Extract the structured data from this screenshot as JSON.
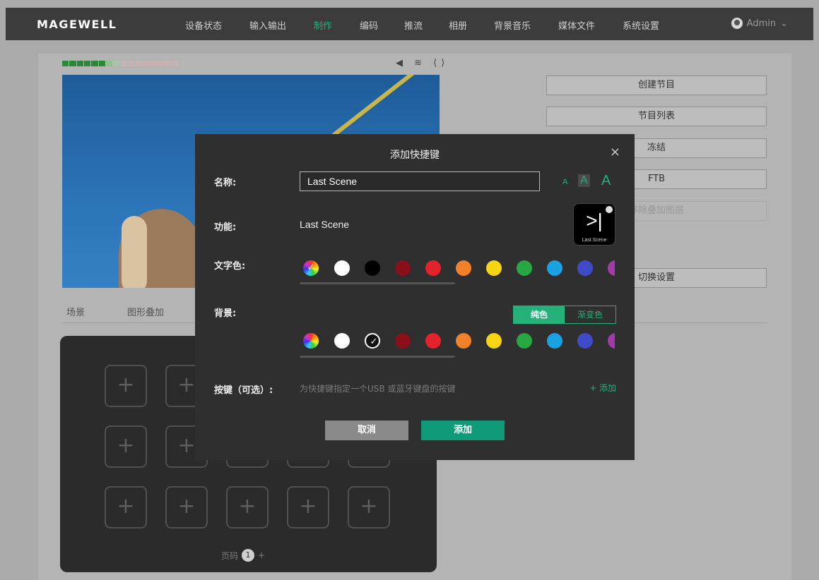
{
  "nav": {
    "logo": "MAGEWELL",
    "items": [
      {
        "label": "设备状态",
        "active": false
      },
      {
        "label": "输入输出",
        "active": false
      },
      {
        "label": "制作",
        "active": true
      },
      {
        "label": "编码",
        "active": false
      },
      {
        "label": "推流",
        "active": false
      },
      {
        "label": "相册",
        "active": false
      },
      {
        "label": "背景音乐",
        "active": false
      },
      {
        "label": "媒体文件",
        "active": false
      },
      {
        "label": "系统设置",
        "active": false
      }
    ],
    "user": "Admin"
  },
  "status_icons": "◀ ≋ ⟨⟩",
  "side_buttons": [
    "创建节目",
    "节目列表",
    "冻结",
    "FTB",
    "移除叠加图层",
    "切换设置"
  ],
  "tabs": [
    "场景",
    "图形叠加"
  ],
  "pad": {
    "page_label": "页码",
    "page_number": "1",
    "add_symbol": "+",
    "cell_symbol": "+"
  },
  "modal": {
    "title": "添加快捷键",
    "close": "×",
    "name_label": "名称:",
    "name_value": "Last Scene",
    "font_sizes": [
      "A",
      "A",
      "A"
    ],
    "function_label": "功能:",
    "function_value": "Last Scene",
    "key_glyph": ">|",
    "key_caption": "Last Scene",
    "text_color_label": "文字色:",
    "background_label": "背景:",
    "bg_modes": [
      "纯色",
      "渐变色"
    ],
    "hotkey_label": "按键（可选）:",
    "hotkey_hint": "为快捷键指定一个USB 或蓝牙键盘的按键",
    "add_label": "+ 添加",
    "cancel_label": "取消",
    "confirm_label": "添加"
  },
  "colors": {
    "accent": "#26b07a",
    "swatches": [
      "#ffffff",
      "#000000",
      "#8b0f1a",
      "#e3232c",
      "#f0822a",
      "#f7d611",
      "#27a843",
      "#1ba1e2",
      "#3f4ac8",
      "#a23aa8"
    ]
  }
}
